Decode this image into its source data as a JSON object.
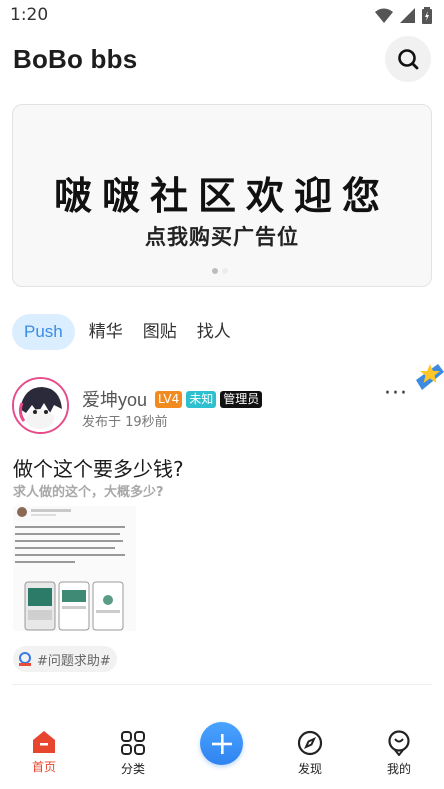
{
  "status_bar": {
    "time": "1:20"
  },
  "header": {
    "title": "BoBo bbs"
  },
  "banner": {
    "title": "啵啵社区欢迎您",
    "subtitle": "点我购买广告位"
  },
  "tabs": [
    {
      "label": "Push"
    },
    {
      "label": "精华"
    },
    {
      "label": "图贴"
    },
    {
      "label": "找人"
    }
  ],
  "post": {
    "username": "爱坤you",
    "badges": {
      "level": "LV4",
      "unknown": "未知",
      "admin": "管理员"
    },
    "time": "发布于 19秒前",
    "more": "···",
    "title": "做个这个要多少钱?",
    "subtitle": "求人做的这个，大概多少?",
    "topic": "#问题求助#"
  },
  "bottom_nav": {
    "home": "首页",
    "category": "分类",
    "discover": "发现",
    "mine": "我的"
  },
  "colors": {
    "accent": "#3a8de6",
    "active_nav": "#e8452e",
    "level_badge": "#f28b1f",
    "unknown_badge": "#2ec0cf",
    "admin_badge": "#111111"
  }
}
